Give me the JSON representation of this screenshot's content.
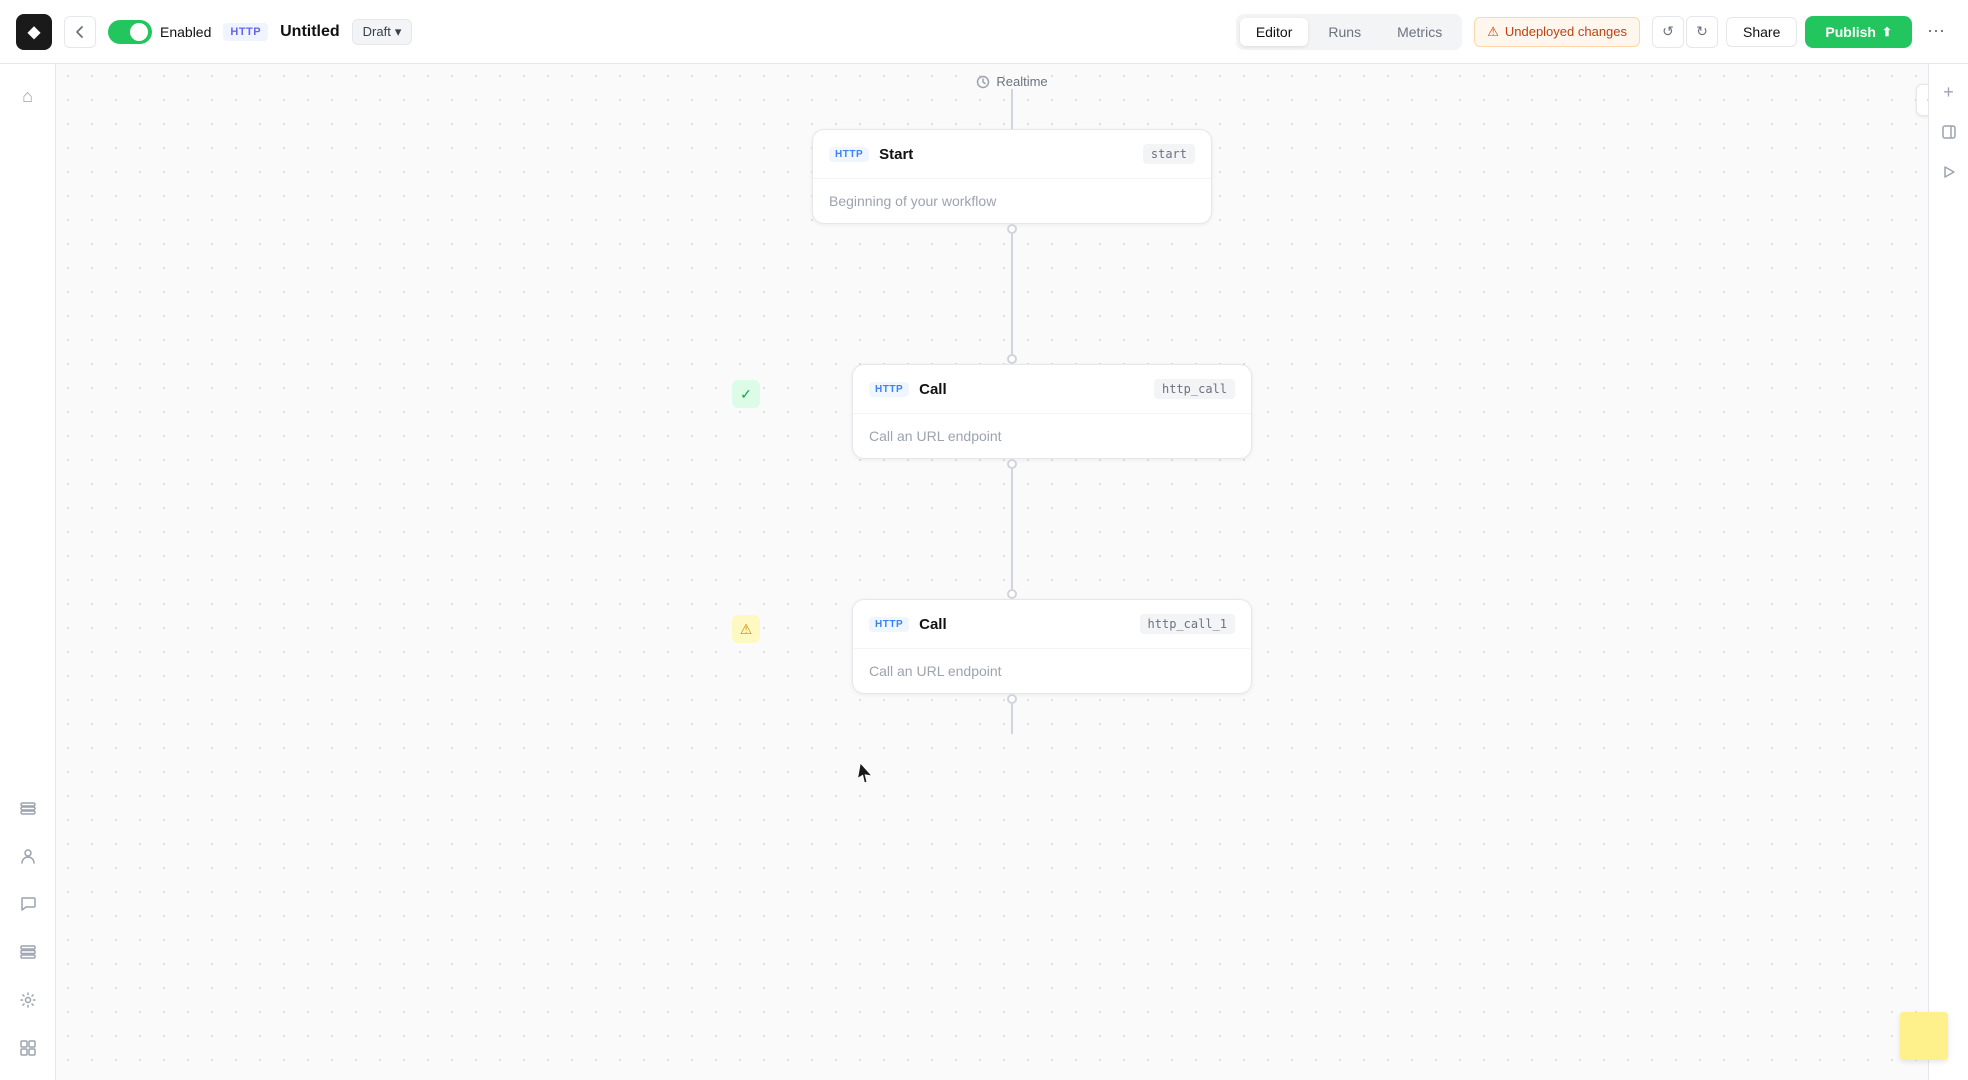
{
  "app": {
    "logo": "◆",
    "title": "Untitled",
    "status": "Draft",
    "enabled_label": "Enabled",
    "http_badge": "HTTP",
    "realtime_label": "Realtime"
  },
  "topbar": {
    "nav_tabs": [
      {
        "id": "editor",
        "label": "Editor",
        "active": true
      },
      {
        "id": "runs",
        "label": "Runs",
        "active": false
      },
      {
        "id": "metrics",
        "label": "Metrics",
        "active": false
      }
    ],
    "undeployed_label": "Undeployed changes",
    "share_label": "Share",
    "publish_label": "Publish",
    "more_label": "⋯"
  },
  "sidebar": {
    "icons": [
      {
        "id": "home",
        "symbol": "⌂"
      },
      {
        "id": "database",
        "symbol": "≡"
      },
      {
        "id": "person",
        "symbol": "○"
      },
      {
        "id": "chat",
        "symbol": "◯"
      },
      {
        "id": "layers",
        "symbol": "▭"
      },
      {
        "id": "settings",
        "symbol": "⚙"
      },
      {
        "id": "history",
        "symbol": "⊞"
      }
    ]
  },
  "right_panel": {
    "icons": [
      {
        "id": "add",
        "symbol": "+"
      },
      {
        "id": "panel",
        "symbol": "▥"
      },
      {
        "id": "play",
        "symbol": "▶"
      }
    ]
  },
  "nodes": {
    "start": {
      "http_badge": "HTTP",
      "title": "Start",
      "id": "start",
      "description": "Beginning of your workflow"
    },
    "call1": {
      "http_badge": "HTTP",
      "title": "Call",
      "id": "http_call",
      "description": "Call an URL endpoint",
      "status": "success"
    },
    "call2": {
      "http_badge": "HTTP",
      "title": "Call",
      "id": "http_call_1",
      "description": "Call an URL endpoint",
      "status": "warning"
    }
  }
}
